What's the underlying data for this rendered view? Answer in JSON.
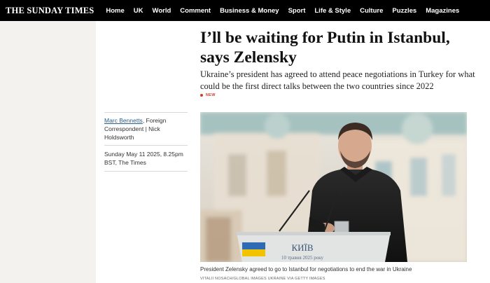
{
  "masthead": "THE SUNDAY TIMES",
  "nav": [
    "Home",
    "UK",
    "World",
    "Comment",
    "Business & Money",
    "Sport",
    "Life & Style",
    "Culture",
    "Puzzles",
    "Magazines"
  ],
  "article": {
    "headline_line1": "I’ll be waiting for Putin in Istanbul,",
    "headline_line2": "says Zelensky",
    "standfirst": "Ukraine’s president has agreed to attend peace negotiations in Turkey for what could be the first direct talks between the two countries since 2022",
    "tag": "NEW",
    "author": "Marc Bennetts",
    "byline_rest": ", Foreign Correspondent | Nick Holdsworth",
    "date": "Sunday May 11 2025, 8.25pm BST, The Times",
    "caption": "President Zelensky agreed to go to Istanbul for negotiations to end the war in Ukraine",
    "credit": "VITALII NOSACH/GLOBAL IMAGES UKRAINE VIA GETTY IMAGES",
    "podium_city": "КИЇВ",
    "podium_date": "10 травня 2025 року"
  },
  "colors": {
    "topbar": "#000000",
    "gutter": "#f4f2ef",
    "accent_red": "#c8452e",
    "author_link": "#2a5d8c"
  },
  "icons": [
    "new-dot-icon",
    "ukraine-flag-icon"
  ]
}
